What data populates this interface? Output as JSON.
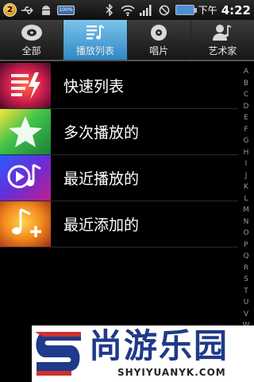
{
  "status_bar": {
    "badge": "2",
    "battery_small_text": "100%",
    "ampm": "下午",
    "time": "4:22"
  },
  "tabs": [
    {
      "label": "全部",
      "icon": "disc-icon",
      "active": false
    },
    {
      "label": "播放列表",
      "icon": "playlist-icon",
      "active": true
    },
    {
      "label": "唱片",
      "icon": "album-icon",
      "active": false
    },
    {
      "label": "艺术家",
      "icon": "artist-icon",
      "active": false
    }
  ],
  "list_items": [
    {
      "label": "快速列表",
      "icon": "quick-list-icon"
    },
    {
      "label": "多次播放的",
      "icon": "star-icon"
    },
    {
      "label": "最近播放的",
      "icon": "recent-play-icon"
    },
    {
      "label": "最近添加的",
      "icon": "music-add-icon"
    }
  ],
  "alpha_index": [
    "A",
    "B",
    "C",
    "D",
    "E",
    "F",
    "G",
    "H",
    "I",
    "J",
    "K",
    "L",
    "M",
    "N",
    "O",
    "P",
    "Q",
    "R",
    "S",
    "T",
    "U",
    "V",
    "W"
  ],
  "banner": {
    "title": "尚游乐园",
    "subtitle": "SHYIYUANYK.COM"
  },
  "colors": {
    "active_tab": "#3a96d2",
    "banner_blue": "#1f3a8a",
    "banner_red": "#d0312d"
  }
}
